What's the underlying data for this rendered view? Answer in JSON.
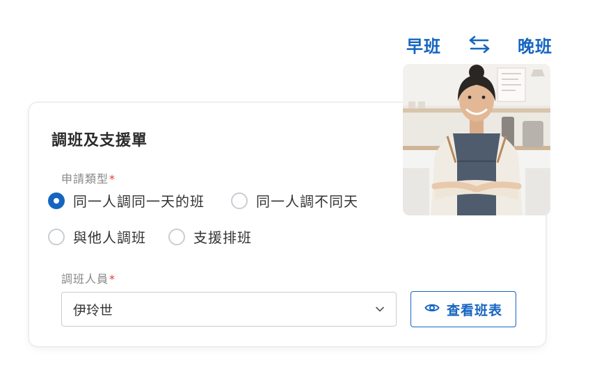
{
  "shift": {
    "from_label": "早班",
    "to_label": "晚班",
    "swap_icon": "swap-arrows-icon"
  },
  "form": {
    "title": "調班及支援單",
    "request_type": {
      "label": "申請類型",
      "required_mark": "*",
      "options": [
        {
          "label": "同一人調同一天的班",
          "selected": true
        },
        {
          "label": "同一人調不同天",
          "selected": false
        },
        {
          "label": "與他人調班",
          "selected": false
        },
        {
          "label": "支援排班",
          "selected": false
        }
      ]
    },
    "staff": {
      "label": "調班人員",
      "required_mark": "*",
      "value": "伊玲世",
      "dropdown_icon": "chevron-down-icon"
    },
    "view_schedule": {
      "label": "查看班表",
      "icon": "eye-icon"
    }
  },
  "colors": {
    "accent": "#1565c0",
    "required": "#e53935",
    "border": "#c9cdd2"
  }
}
